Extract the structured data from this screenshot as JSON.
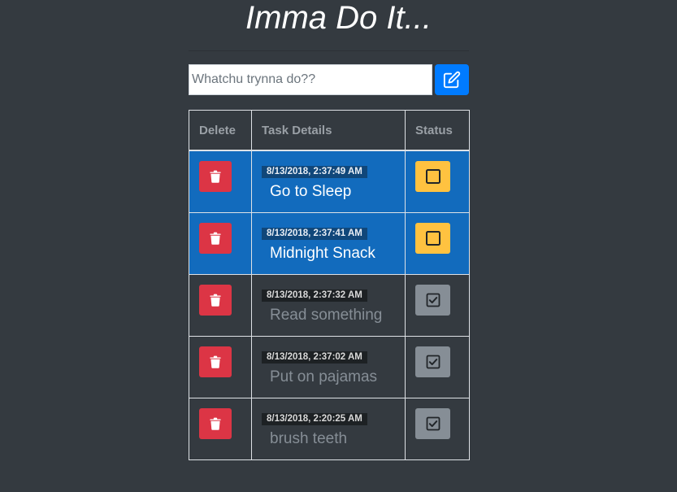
{
  "app": {
    "title": "Imma Do It..."
  },
  "new_task": {
    "placeholder": "Whatchu trynna do??",
    "add_button_icon": "edit-icon"
  },
  "table": {
    "headers": {
      "delete": "Delete",
      "details": "Task Details",
      "status": "Status"
    },
    "rows": [
      {
        "timestamp": "8/13/2018, 2:37:49 AM",
        "title": "Go to Sleep",
        "status": "open"
      },
      {
        "timestamp": "8/13/2018, 2:37:41 AM",
        "title": "Midnight Snack",
        "status": "open"
      },
      {
        "timestamp": "8/13/2018, 2:37:32 AM",
        "title": "Read something",
        "status": "done"
      },
      {
        "timestamp": "8/13/2018, 2:37:02 AM",
        "title": "Put on pajamas",
        "status": "done"
      },
      {
        "timestamp": "8/13/2018, 2:20:25 AM",
        "title": "brush teeth",
        "status": "done"
      }
    ]
  },
  "icons": {
    "delete": "trash-icon",
    "open_status": "empty-checkbox-icon",
    "done_status": "checked-checkbox-icon"
  },
  "colors": {
    "background": "#343a40",
    "open_row": "#126bbd",
    "delete_button": "#dc3545",
    "open_status_button": "#ffc240",
    "done_status_button": "#868e96",
    "add_button": "#007bff"
  }
}
